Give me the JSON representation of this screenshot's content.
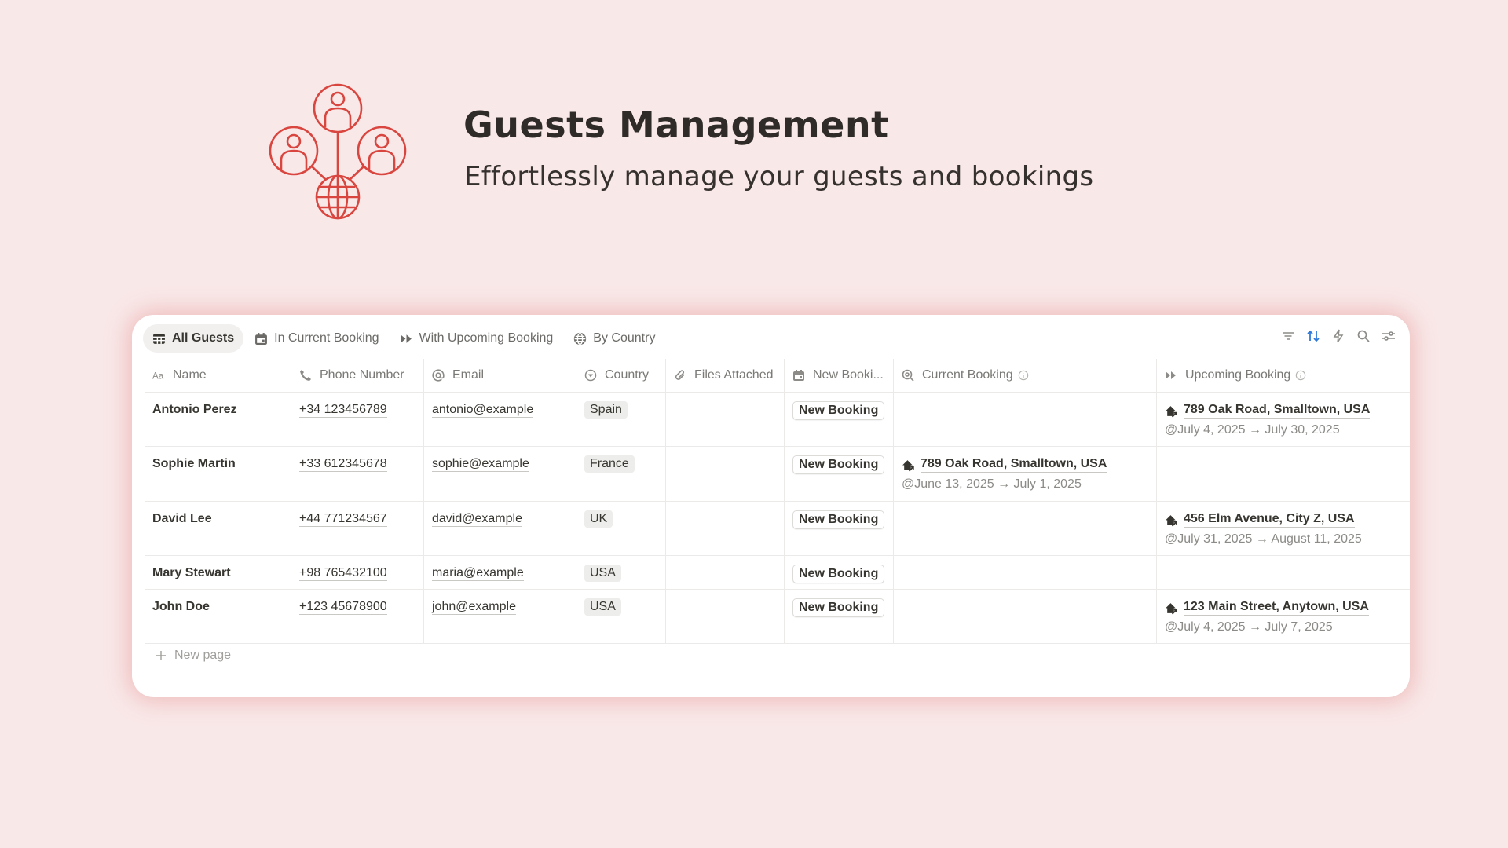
{
  "header": {
    "title": "Guests Management",
    "subtitle": "Effortlessly manage your guests and bookings",
    "icon": "guests-globe-icon",
    "accent": "#d9453f"
  },
  "tabs": [
    {
      "label": "All Guests",
      "icon": "table-icon",
      "active": true
    },
    {
      "label": "In Current Booking",
      "icon": "calendar-icon",
      "active": false
    },
    {
      "label": "With Upcoming Booking",
      "icon": "fast-forward-icon",
      "active": false
    },
    {
      "label": "By Country",
      "icon": "globe-icon",
      "active": false
    }
  ],
  "toolbar": [
    "filter-icon",
    "sort-icon",
    "automation-icon",
    "search-icon",
    "settings-icon"
  ],
  "columns": [
    {
      "label": "Name",
      "icon": "text-icon"
    },
    {
      "label": "Phone Number",
      "icon": "phone-icon"
    },
    {
      "label": "Email",
      "icon": "at-icon"
    },
    {
      "label": "Country",
      "icon": "select-icon"
    },
    {
      "label": "Files Attached",
      "icon": "paperclip-icon"
    },
    {
      "label": "New Booki...",
      "icon": "calendar-icon"
    },
    {
      "label": "Current Booking",
      "icon": "search-relation-icon"
    },
    {
      "label": "Upcoming Booking",
      "icon": "fast-forward-icon"
    }
  ],
  "rows": [
    {
      "name": "Antonio Perez",
      "phone": "+34 123456789",
      "email": "antonio@example",
      "country": "Spain",
      "button": "New Booking",
      "current": {
        "title": "",
        "date": ""
      },
      "upcoming": {
        "title": "789 Oak Road, Smalltown, USA",
        "date": "@July 4, 2025 → July 30, 2025"
      }
    },
    {
      "name": "Sophie Martin",
      "phone": "+33 612345678",
      "email": "sophie@example",
      "country": "France",
      "button": "New Booking",
      "current": {
        "title": "789 Oak Road, Smalltown, USA",
        "date": "@June 13, 2025 → July 1, 2025"
      },
      "upcoming": {
        "title": "",
        "date": ""
      }
    },
    {
      "name": "David Lee",
      "phone": "+44 771234567",
      "email": "david@example",
      "country": "UK",
      "button": "New Booking",
      "current": {
        "title": "",
        "date": ""
      },
      "upcoming": {
        "title": "456 Elm Avenue, City Z, USA",
        "date": "@July 31, 2025 → August 11, 2025"
      }
    },
    {
      "name": "Mary Stewart",
      "phone": "+98 765432100",
      "email": "maria@example",
      "country": "USA",
      "button": "New Booking",
      "current": {
        "title": "",
        "date": ""
      },
      "upcoming": {
        "title": "",
        "date": ""
      }
    },
    {
      "name": "John Doe",
      "phone": "+123 45678900",
      "email": "john@example",
      "country": "USA",
      "button": "New Booking",
      "current": {
        "title": "",
        "date": ""
      },
      "upcoming": {
        "title": "123 Main Street, Anytown, USA",
        "date": "@July 4, 2025 → July 7, 2025"
      }
    }
  ],
  "new_page_label": "New page"
}
